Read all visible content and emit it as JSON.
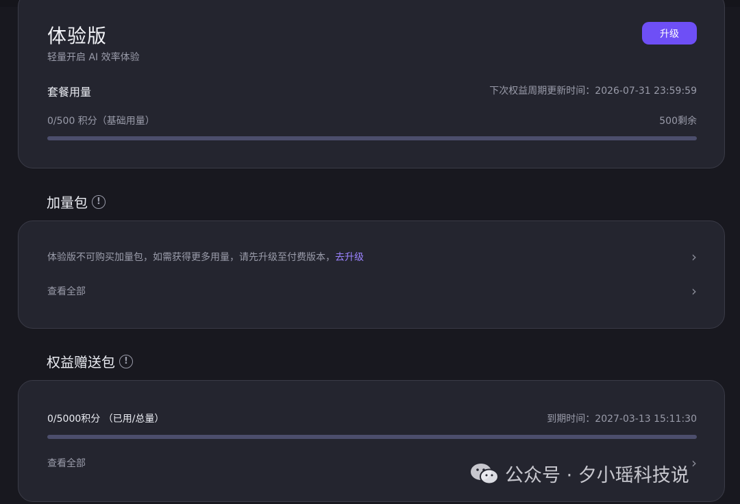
{
  "plan": {
    "name": "体验版",
    "description": "轻量开启 AI 效率体验",
    "upgrade_label": "升级",
    "usage_title": "套餐用量",
    "renew_text": "下次权益周期更新时间：2026-07-31 23:59:59",
    "quota_label": "0/500 积分（基础用量）",
    "remaining_label": "500剩余",
    "used_fraction": 0
  },
  "addon": {
    "title": "加量包",
    "notice": "体验版不可购买加量包，如需获得更多用量，请先升级至付费版本，",
    "notice_link": "去升级",
    "view_all": "查看全部"
  },
  "gift": {
    "title": "权益赠送包",
    "used_label": "0/5000积分 （已用/总量）",
    "expire_text": "到期时间：2027-03-13 15:11:30",
    "view_all": "查看全部",
    "used_fraction": 0
  },
  "watermark": {
    "text": "公众号 · 夕小瑶科技说",
    "icon": "wechat-icon"
  },
  "colors": {
    "accent": "#6e4ff6",
    "link": "#9b83ff",
    "card_bg": "#24252f",
    "page_bg": "#18181f"
  }
}
